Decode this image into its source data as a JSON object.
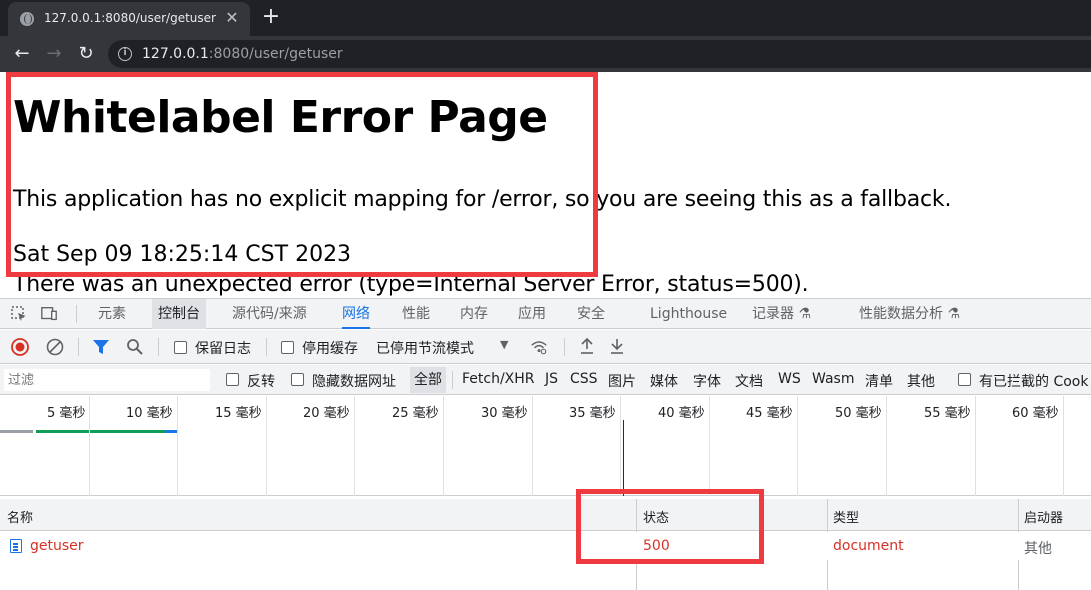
{
  "browser": {
    "tab_title": "127.0.0.1:8080/user/getuser",
    "tab_close": "✕",
    "new_tab": "+",
    "url_host": "127.0.0.1",
    "url_rest": ":8080/user/getuser"
  },
  "page": {
    "heading": "Whitelabel Error Page",
    "message": "This application has no explicit mapping for /error, so you are seeing this as a fallback.",
    "timestamp": "Sat Sep 09 18:25:14 CST 2023",
    "error_line": "There was an unexpected error (type=Internal Server Error, status=500)."
  },
  "devtools": {
    "tabs": [
      "元素",
      "控制台",
      "源代码/来源",
      "网络",
      "性能",
      "内存",
      "应用",
      "安全",
      "Lighthouse",
      "记录器 ⚗",
      "性能数据分析 ⚗"
    ],
    "selected_tab": "网络",
    "network_toolbar": {
      "preserve_log": "保留日志",
      "disable_cache": "停用缓存",
      "throttling": "已停用节流模式"
    },
    "filter": {
      "placeholder": "过滤",
      "invert": "反转",
      "hide_data_urls": "隐藏数据网址",
      "types": [
        "全部",
        "Fetch/XHR",
        "JS",
        "CSS",
        "图片",
        "媒体",
        "字体",
        "文档",
        "WS",
        "Wasm",
        "清单",
        "其他"
      ],
      "blocked": "有已拦截的 Cook"
    },
    "timeline_ticks": [
      "5 毫秒",
      "10 毫秒",
      "15 毫秒",
      "20 毫秒",
      "25 毫秒",
      "30 毫秒",
      "35 毫秒",
      "40 毫秒",
      "45 毫秒",
      "50 毫秒",
      "55 毫秒",
      "60 毫秒"
    ],
    "columns": {
      "name": "名称",
      "status": "状态",
      "type": "类型",
      "initiator": "启动器"
    },
    "rows": [
      {
        "name": "getuser",
        "status": "500",
        "type": "document",
        "initiator": "其他"
      }
    ],
    "colors": {
      "accent": "#1a73e8",
      "error": "#d93025",
      "highlight_box": "#ef3b3f"
    }
  }
}
